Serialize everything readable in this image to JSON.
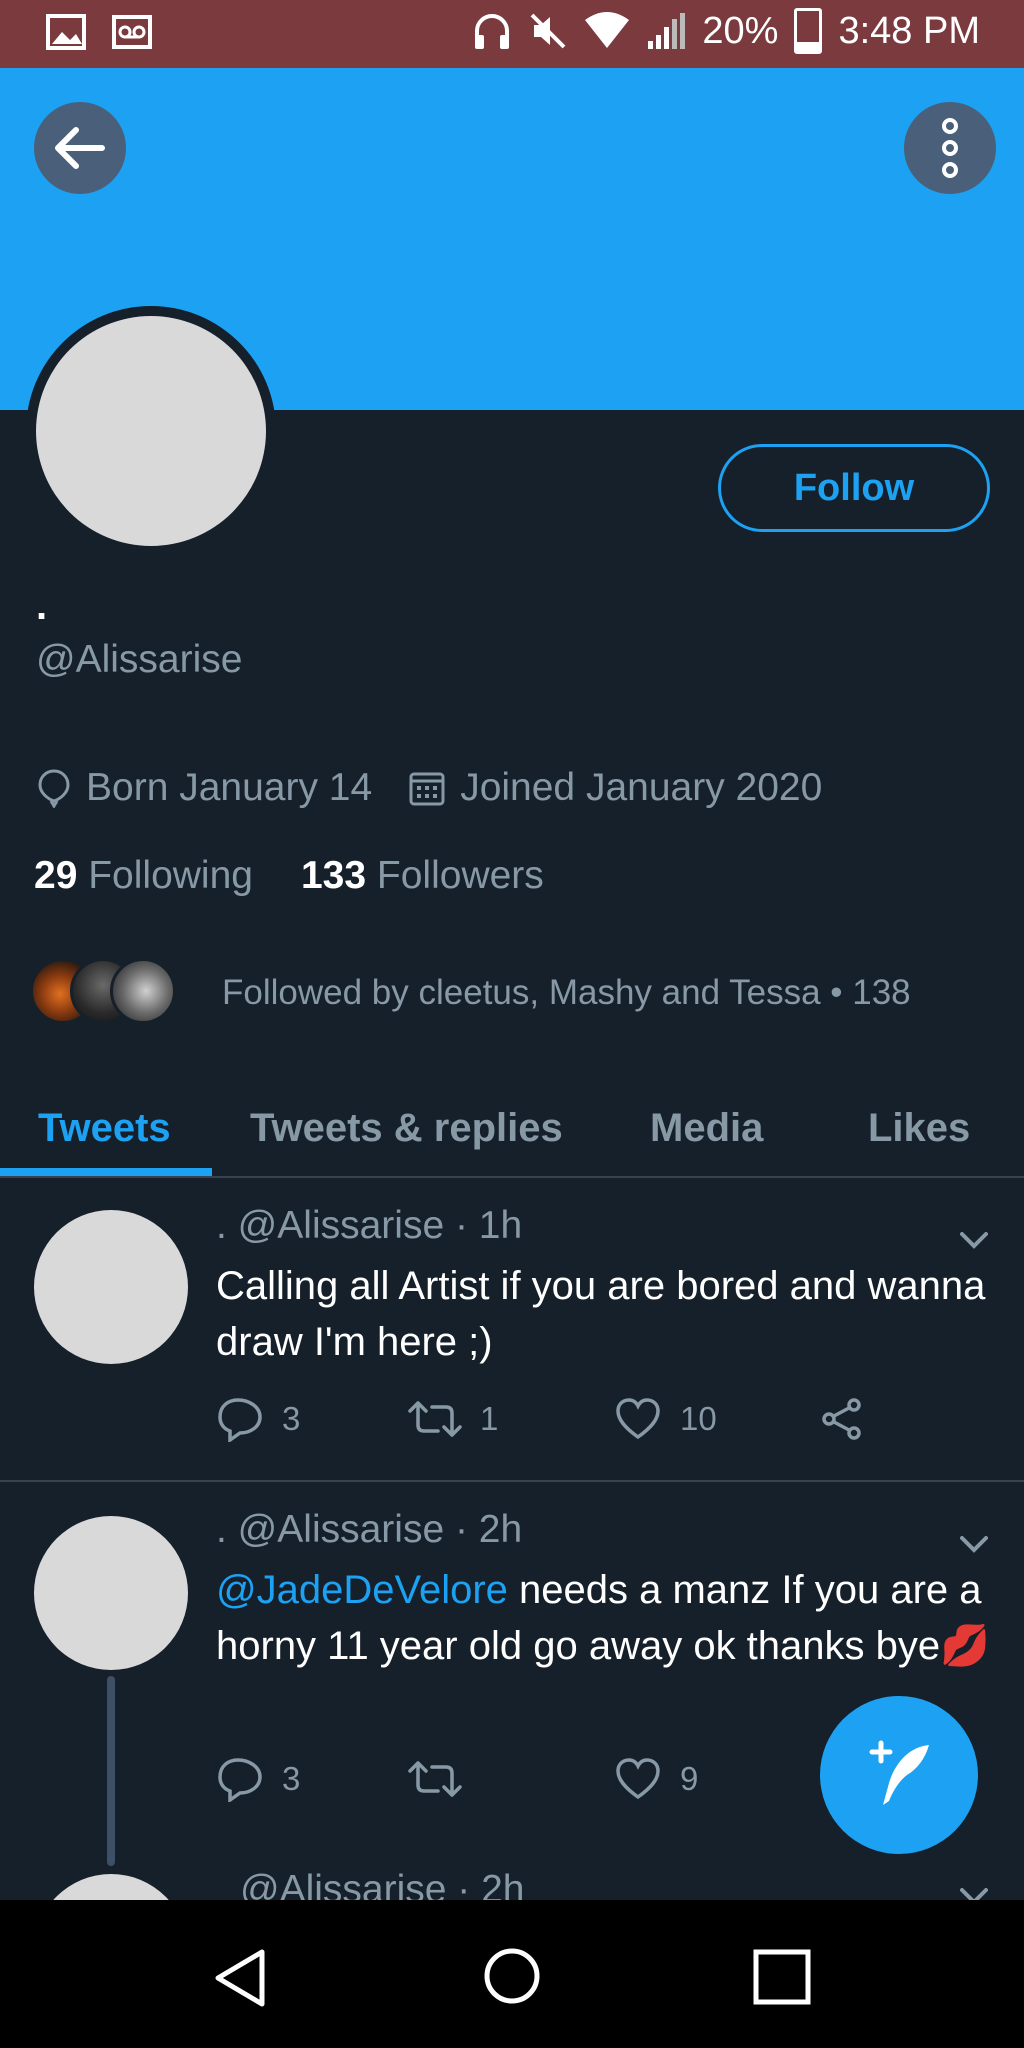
{
  "status_bar": {
    "battery": "20%",
    "time": "3:48 PM",
    "icons": [
      "image-icon",
      "voicemail-icon",
      "headphones-icon",
      "mute-icon",
      "wifi-icon",
      "signal-icon",
      "battery-icon"
    ]
  },
  "profile": {
    "display_name": ".",
    "handle": "@Alissarise",
    "follow_label": "Follow",
    "born": "Born January 14",
    "joined": "Joined January 2020",
    "following_count": "29",
    "following_label": "Following",
    "followers_count": "133",
    "followers_label": "Followers",
    "followed_by": "Followed by cleetus, Mashy and Tessa • 138"
  },
  "tabs": [
    {
      "label": "Tweets",
      "active": true
    },
    {
      "label": "Tweets & replies",
      "active": false
    },
    {
      "label": "Media",
      "active": false
    },
    {
      "label": "Likes",
      "active": false
    }
  ],
  "tweets": [
    {
      "header": ". @Alissarise · 1h",
      "body": "Calling all Artist if you are bored and wanna draw I'm here ;)",
      "replies": "3",
      "retweets": "1",
      "likes": "10"
    },
    {
      "header": ". @Alissarise · 2h",
      "mention": "@JadeDeVelore",
      "body": " needs a manz If you are a horny 11 year old go away ok thanks bye",
      "emoji": "💋",
      "replies": "3",
      "retweets": "",
      "likes": "9"
    },
    {
      "header": "@Alissarise · 2h"
    }
  ],
  "colors": {
    "accent": "#1da1f2",
    "background": "#15202b",
    "muted": "#8899a6",
    "status_bar": "#7a3a3e"
  }
}
